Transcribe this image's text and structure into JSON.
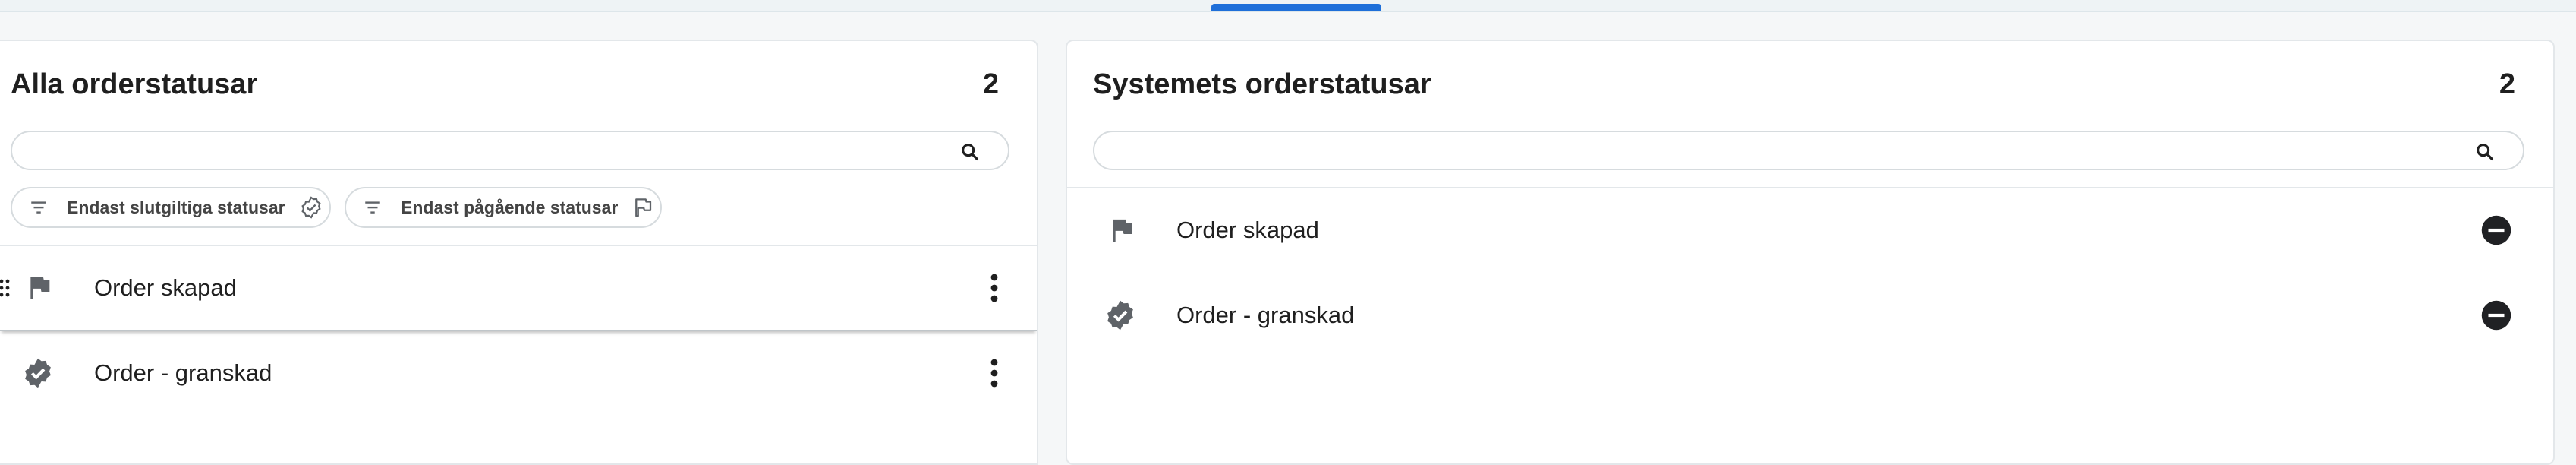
{
  "left_panel": {
    "title": "Alla orderstatusar",
    "count": "2",
    "search": {
      "value": "",
      "placeholder": ""
    },
    "filters": [
      {
        "label": "Endast slutgiltiga statusar",
        "icon": "check-badge-icon"
      },
      {
        "label": "Endast pågående statusar",
        "icon": "flag-outline-icon"
      }
    ],
    "items": [
      {
        "label": "Order skapad",
        "icon": "flag-icon"
      },
      {
        "label": "Order - granskad",
        "icon": "verified-badge-icon"
      }
    ]
  },
  "right_panel": {
    "title": "Systemets orderstatusar",
    "count": "2",
    "search": {
      "value": "",
      "placeholder": ""
    },
    "items": [
      {
        "label": "Order skapad",
        "icon": "flag-icon",
        "action_icon": "remove-circle-icon"
      },
      {
        "label": "Order - granskad",
        "icon": "verified-badge-icon",
        "action_icon": "remove-circle-icon"
      }
    ]
  },
  "colors": {
    "accent": "#1e6fd9",
    "icon_gray": "#5f6368",
    "remove_button": "#202124"
  }
}
